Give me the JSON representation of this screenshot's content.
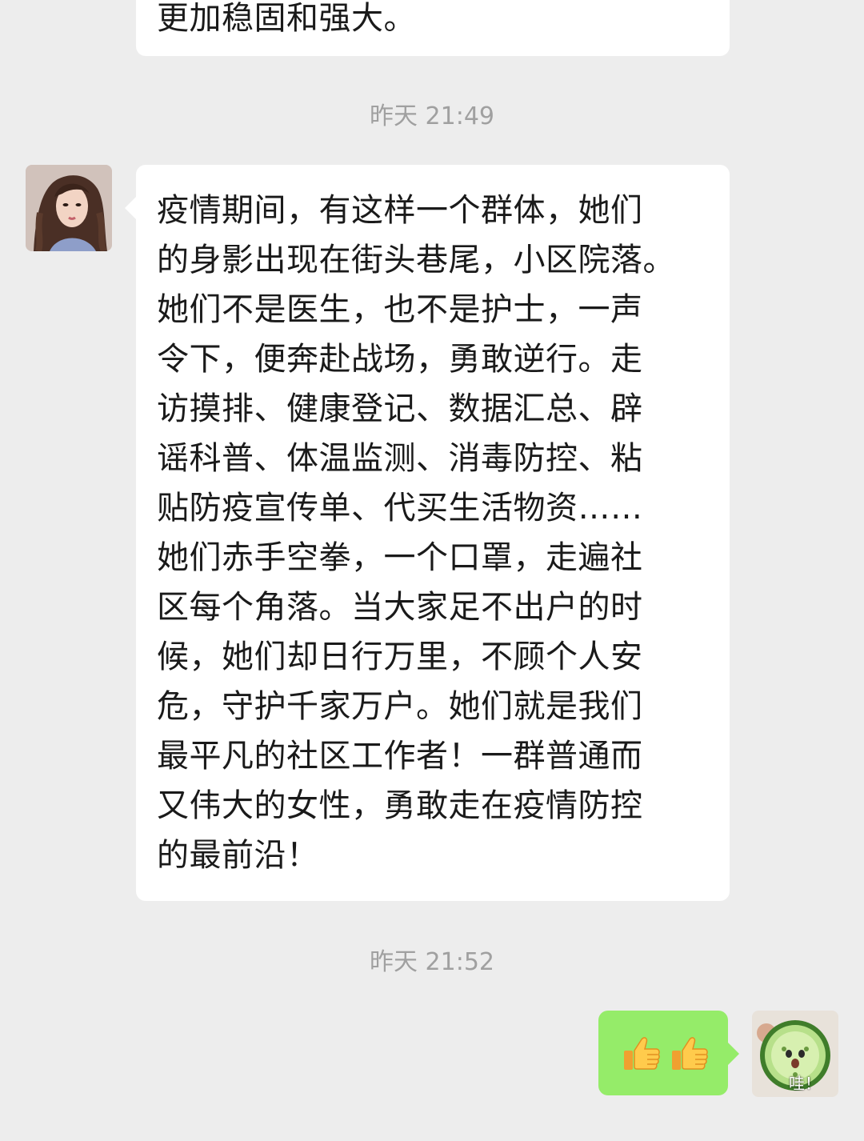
{
  "chat": {
    "previous_message": {
      "text": "更加稳固和强大。"
    },
    "timestamp_1": "昨天 21:49",
    "incoming_message": {
      "avatar_icon": "woman-portrait-avatar",
      "text": "疫情期间，有这样一个群体，她们\n的身影出现在街头巷尾，小区院落。\n她们不是医生，也不是护士，一声\n令下，便奔赴战场，勇敢逆行。走\n访摸排、健康登记、数据汇总、辟\n谣科普、体温监测、消毒防控、粘\n贴防疫宣传单、代买生活物资……\n她们赤手空拳，一个口罩，走遍社\n区每个角落。当大家足不出户的时\n候，她们却日行万里，不顾个人安\n危，守护千家万户。她们就是我们\n最平凡的社区工作者！一群普通而\n又伟大的女性，勇敢走在疫情防控\n的最前沿！"
    },
    "timestamp_2": "昨天 21:52",
    "outgoing_message": {
      "emojis": [
        "thumbs-up-icon",
        "thumbs-up-icon"
      ],
      "avatar_icon": "cucumber-sticker-avatar",
      "avatar_caption": "哇！"
    }
  },
  "colors": {
    "background": "#ededed",
    "incoming_bubble": "#ffffff",
    "outgoing_bubble": "#95ec69",
    "timestamp_text": "#a0a0a0"
  }
}
